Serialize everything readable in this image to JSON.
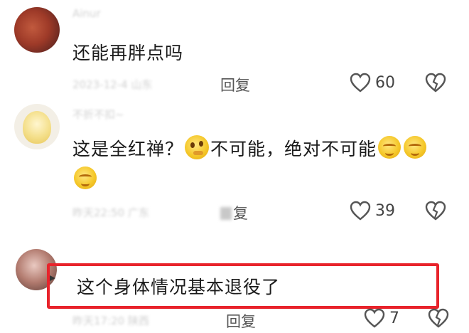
{
  "comments": [
    {
      "author": "Ainur",
      "text": "还能再胖点吗",
      "meta": "2023-12-4 山东",
      "reply_label": "回复",
      "likes": "60"
    },
    {
      "author": "不折不扣~",
      "text_part1": "这是全红禅？",
      "text_part2": "不可能，绝对不可能",
      "meta": "昨天22:50 广东",
      "reply_label": "复",
      "likes": "39"
    },
    {
      "text": "这个身体情况基本退役了",
      "meta": "昨天17:20 陕西",
      "reply_label": "回复",
      "likes": "7"
    }
  ],
  "icons": {
    "like": "heart-outline-icon",
    "dislike": "broken-heart-icon",
    "emoji_think": "thinking-face-emoji",
    "emoji_sweat": "sweating-face-emoji"
  },
  "colors": {
    "highlight": "#e8232b",
    "text": "#1a1a1a",
    "muted": "#555555"
  }
}
